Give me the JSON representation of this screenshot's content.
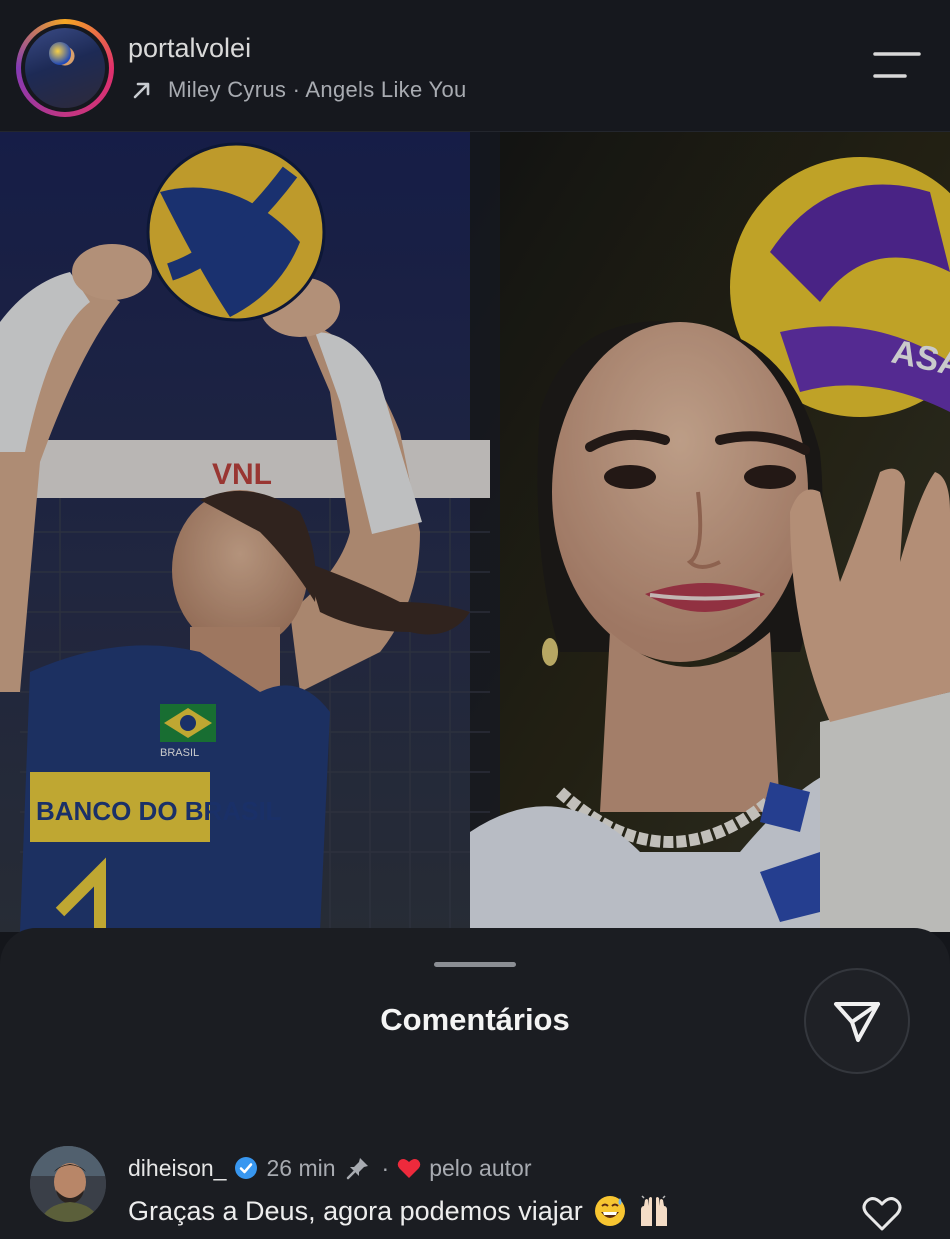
{
  "header": {
    "username": "portalvolei",
    "music": "Miley Cyrus · Angels Like You"
  },
  "photo": {
    "ball_left_text": "MIKASA",
    "net_text": "VNL",
    "jersey_text": "BANCO DO BRASIL",
    "flag_text": "BRASIL"
  },
  "sheet": {
    "title": "Comentários"
  },
  "comment": {
    "username": "diheison_",
    "time": "26 min",
    "separator": "·",
    "author_tag": "pelo autor",
    "text": "Graças a Deus, agora podemos viajar",
    "emojis": [
      "grinning-sweat-face",
      "raised-hands"
    ]
  },
  "colors": {
    "background": "#14161b",
    "sheet": "#1b1d22",
    "verified": "#3897f0",
    "heart": "#ed2a3c"
  }
}
